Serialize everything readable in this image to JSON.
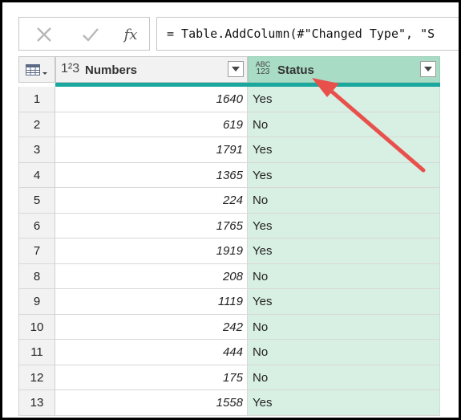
{
  "formula_bar": {
    "cancel_icon": "close-icon",
    "confirm_icon": "check-icon",
    "fx_label": "fx",
    "formula": "= Table.AddColumn(#\"Changed Type\", \"S"
  },
  "columns": [
    {
      "type_icon": "1²3",
      "title": "Numbers"
    },
    {
      "type_icon_top": "ABC",
      "type_icon_bottom": "123",
      "title": "Status"
    }
  ],
  "rows": [
    {
      "index": "1",
      "number": "1640",
      "status": "Yes"
    },
    {
      "index": "2",
      "number": "619",
      "status": "No"
    },
    {
      "index": "3",
      "number": "1791",
      "status": "Yes"
    },
    {
      "index": "4",
      "number": "1365",
      "status": "Yes"
    },
    {
      "index": "5",
      "number": "224",
      "status": "No"
    },
    {
      "index": "6",
      "number": "1765",
      "status": "Yes"
    },
    {
      "index": "7",
      "number": "1919",
      "status": "Yes"
    },
    {
      "index": "8",
      "number": "208",
      "status": "No"
    },
    {
      "index": "9",
      "number": "1119",
      "status": "Yes"
    },
    {
      "index": "10",
      "number": "242",
      "status": "No"
    },
    {
      "index": "11",
      "number": "444",
      "status": "No"
    },
    {
      "index": "12",
      "number": "175",
      "status": "No"
    },
    {
      "index": "13",
      "number": "1558",
      "status": "Yes"
    }
  ],
  "colors": {
    "status_header": "#a9dcc5",
    "status_cells": "#d8efe3",
    "accent_bar": "#1aa89e",
    "arrow": "#e8504b"
  }
}
